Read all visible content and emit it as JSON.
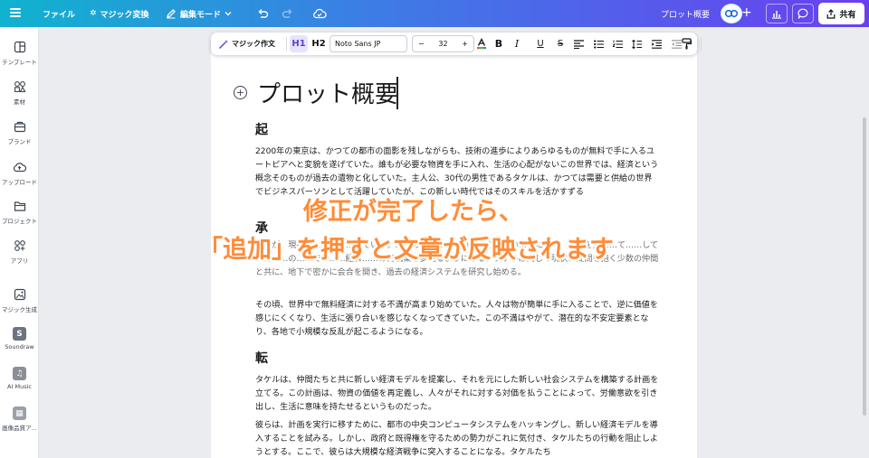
{
  "topbar": {
    "file": "ファイル",
    "magic_switch": "マジック変換",
    "edit_mode": "編集モード",
    "doc_title": "プロット概要",
    "share": "共有"
  },
  "sidebar": {
    "items": [
      {
        "label": "テンプレート",
        "icon": "template-icon"
      },
      {
        "label": "素材",
        "icon": "elements-icon"
      },
      {
        "label": "ブランド",
        "icon": "brand-icon"
      },
      {
        "label": "アップロード",
        "icon": "upload-icon"
      },
      {
        "label": "プロジェクト",
        "icon": "folder-icon"
      },
      {
        "label": "アプリ",
        "icon": "apps-icon"
      },
      {
        "label": "マジック生成",
        "icon": "magic-media-icon"
      },
      {
        "label": "Soundraw",
        "icon": "soundraw-icon",
        "glyph": "S"
      },
      {
        "label": "AI Music",
        "icon": "music-note-icon",
        "glyph": "♫"
      },
      {
        "label": "画像品質ア...",
        "icon": "image-quality-icon",
        "glyph": "▦"
      }
    ]
  },
  "text_toolbar": {
    "magic_write": "マジック作文",
    "h1": "H1",
    "h2": "H2",
    "font": "Noto Sans JP",
    "size": "32",
    "minus": "−",
    "plus": "+"
  },
  "doc": {
    "title": "プロット概要",
    "sections": [
      {
        "heading": "起",
        "paragraphs": [
          "2200年の東京は、かつての都市の面影を残しながらも、技術の進歩によりあらゆるものが無料で手に入るユートピアへと変貌を遂げていた。誰もが必要な物資を手に入れ、生活の心配がないこの世界では、経済という概念そのものが過去の遺物と化していた。主人公、30代の男性であるタケルは、かつては需要と供給の世界でビジネスパーソンとして活躍していたが、この新しい時代ではそのスキルを活かすずる"
        ]
      },
      {
        "heading": "承",
        "paragraphs": [
          "あるが、現在は……的に……ていた。……の……に……の……力……の……に……、……を見……て……していた……の……で、……経済……の再構築を夢見るようになる。タケルは同じく現状に疑問を抱く少数の仲間と共に、地下で密かに会合を開き、過去の経済システムを研究し始める。",
          "その頃、世界中で無料経済に対する不満が高まり始めていた。人々は物が簡単に手に入ることで、逆に価値を感じにくくなり、生活に張り合いを感じなくなってきていた。この不満はやがて、潜在的な不安定要素となり、各地で小規模な反乱が起こるようになる。"
        ]
      },
      {
        "heading": "転",
        "paragraphs": [
          "タケルは、仲間たちと共に新しい経済モデルを提案し、それを元にした新しい社会システムを構築する計画を立てる。この計画は、物資の価値を再定義し、人々がそれに対する対価を払うことによって、労働意欲を引き出し、生活に意味を持たせるというものだった。",
          "彼らは、計画を実行に移すために、都市の中央コンピュータシステムをハッキングし、新しい経済モデルを導入することを試みる。しかし、政府と既得権を守るための勢力がこれに気付き、タケルたちの行動を阻止しようとする。ここで、彼らは大規模な経済戦争に突入することになる。タケルたち"
        ]
      }
    ]
  },
  "overlay": {
    "line1": "修正が完了したら、",
    "line2": "「追加」を押すと文章が反映されます"
  },
  "colors": {
    "topbar_gradient": [
      "#10b3cf",
      "#3f7ae6",
      "#6a3ff0"
    ],
    "overlay_text": "#ff8c38",
    "h1_active": "#5b3fd6"
  }
}
